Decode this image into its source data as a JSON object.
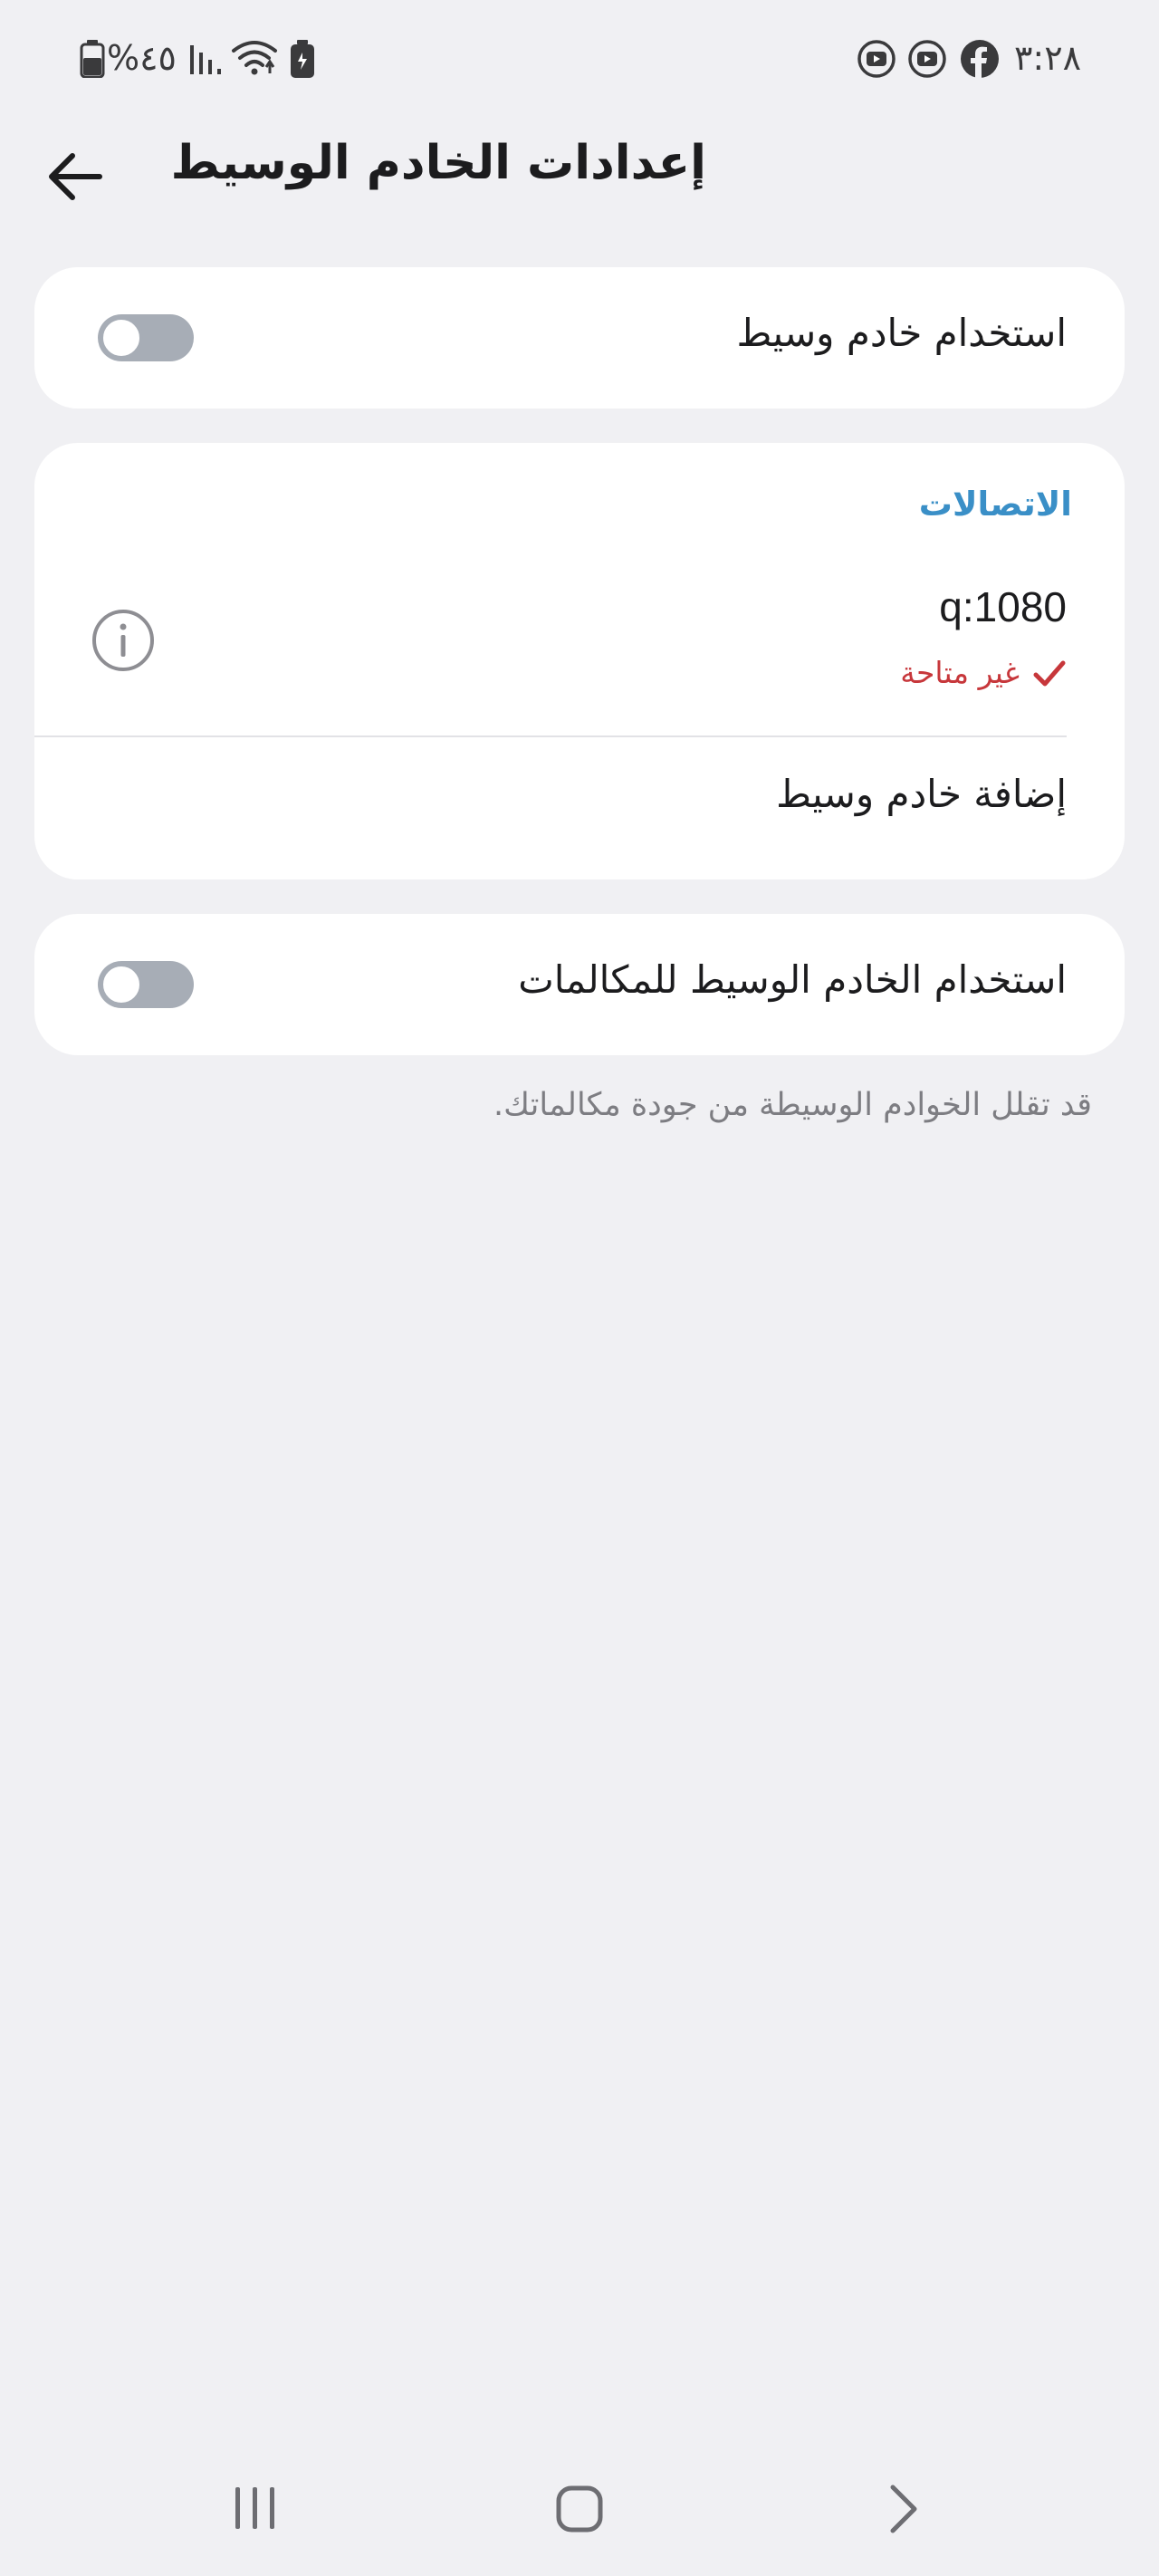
{
  "status_bar": {
    "time": "٣:٢٨",
    "battery_percent": "%٤٥",
    "left_icons": [
      "battery-icon",
      "signal-icon",
      "wifi-icon",
      "battery-saver-icon"
    ],
    "right_icons": [
      "youtube-icon",
      "youtube-icon",
      "facebook-icon"
    ]
  },
  "header": {
    "title": "إعدادات الخادم الوسيط",
    "back_icon": "back-arrow-icon"
  },
  "use_proxy": {
    "label": "استخدام خادم وسيط",
    "enabled": false
  },
  "connections": {
    "section_title": "الاتصالات",
    "proxy": {
      "address": "q:1080",
      "status": "غير متاحة",
      "status_icon": "check-icon",
      "info_icon": "info-icon"
    },
    "add_proxy_label": "إضافة خادم وسيط"
  },
  "use_proxy_calls": {
    "label": "استخدام الخادم الوسيط للمكالمات",
    "enabled": false,
    "footnote": "قد تقلل الخوادم الوسيطة من جودة مكالماتك."
  },
  "nav_bar": {
    "icons": [
      "recent-apps-icon",
      "home-icon",
      "back-icon"
    ]
  },
  "colors": {
    "background": "#f0f0f3",
    "card": "#ffffff",
    "accent": "#3a8fc7",
    "error": "#c7373b",
    "toggle_off": "#a7adb6"
  }
}
